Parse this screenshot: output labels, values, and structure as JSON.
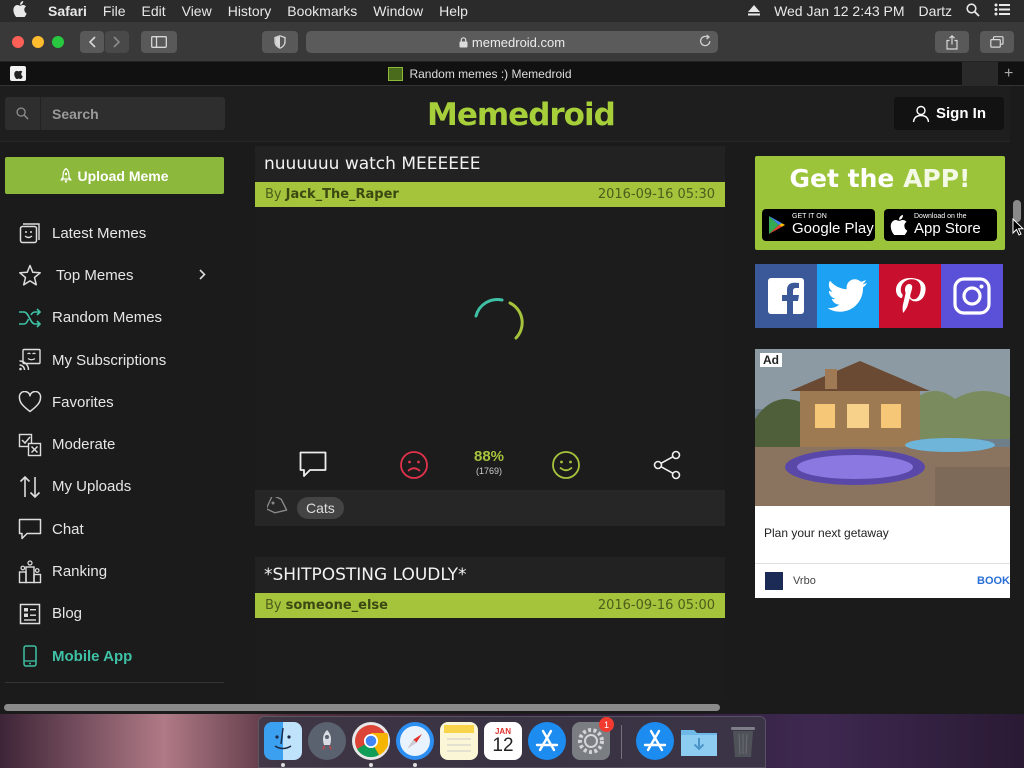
{
  "menubar": {
    "app": "Safari",
    "items": [
      "File",
      "Edit",
      "View",
      "History",
      "Bookmarks",
      "Window",
      "Help"
    ],
    "datetime": "Wed Jan 12  2:43 PM",
    "user": "Dartz"
  },
  "browser": {
    "url": "memedroid.com",
    "tab_title": "Random memes :) Memedroid"
  },
  "header": {
    "search_placeholder": "Search",
    "logo": "Memedroid",
    "signin_label": "Sign In"
  },
  "sidebar": {
    "upload_label": "Upload Meme",
    "items": [
      {
        "label": "Latest Memes",
        "icon": "smiley-box-icon"
      },
      {
        "label": "Top Memes",
        "icon": "star-icon"
      },
      {
        "label": "Random Memes",
        "icon": "shuffle-icon"
      },
      {
        "label": "My Subscriptions",
        "icon": "subscriptions-icon"
      },
      {
        "label": "Favorites",
        "icon": "heart-icon"
      },
      {
        "label": "Moderate",
        "icon": "moderate-icon"
      },
      {
        "label": "My Uploads",
        "icon": "up-down-arrows-icon"
      },
      {
        "label": "Chat",
        "icon": "chat-icon"
      },
      {
        "label": "Ranking",
        "icon": "ranking-icon"
      },
      {
        "label": "Blog",
        "icon": "blog-icon"
      },
      {
        "label": "Mobile App",
        "icon": "mobile-icon"
      }
    ]
  },
  "posts": [
    {
      "title": "nuuuuuu watch MEEEEEE",
      "by": "By",
      "author": "Jack_The_Raper",
      "date": "2016-09-16 05:30",
      "rating": "88%",
      "votes": "(1769)",
      "tags": [
        "Cats"
      ]
    },
    {
      "title": "*SHITPOSTING LOUDLY*",
      "by": "By",
      "author": "someone_else",
      "date": "2016-09-16 05:00"
    }
  ],
  "right": {
    "getapp_prefix": "Get the ",
    "getapp_highlight": "APP!",
    "google_small": "GET IT ON",
    "google_big": "Google Play",
    "apple_small": "Download on the",
    "apple_big": "App Store",
    "ad_label": "Ad",
    "ad_text": "Plan your next getaway",
    "ad_brand": "Vrbo",
    "ad_cta": "BOOK"
  },
  "dock": {
    "calendar_month": "JAN",
    "calendar_day": "12",
    "badge": "1"
  },
  "colors": {
    "brand_green": "#a6cf3a",
    "accent_teal": "#3fc1a6",
    "dislike_red": "#e0324b",
    "like_green": "#a6c33c"
  }
}
